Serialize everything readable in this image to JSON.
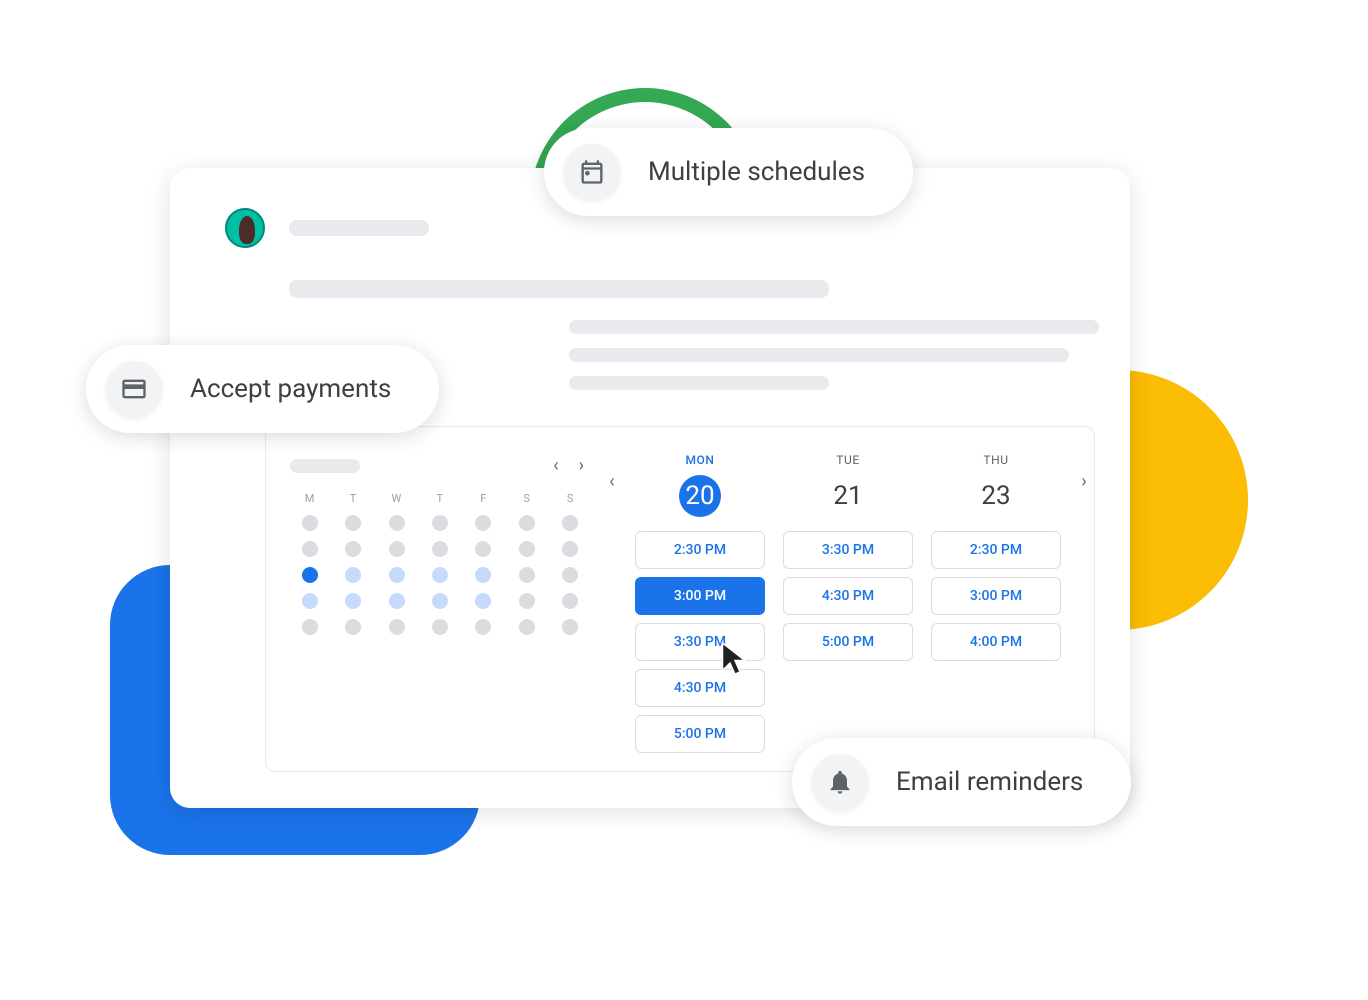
{
  "chips": {
    "multiple": "Multiple schedules",
    "payments": "Accept payments",
    "reminders": "Email reminders"
  },
  "calendar": {
    "weekdays": [
      "M",
      "T",
      "W",
      "T",
      "F",
      "S",
      "S"
    ],
    "rows": [
      [
        "g",
        "g",
        "g",
        "g",
        "g",
        "g",
        "g"
      ],
      [
        "g",
        "g",
        "g",
        "g",
        "g",
        "g",
        "g"
      ],
      [
        "sel",
        "a",
        "a",
        "a",
        "a",
        "g",
        "g"
      ],
      [
        "a",
        "a",
        "a",
        "a",
        "a",
        "g",
        "g"
      ],
      [
        "g",
        "g",
        "g",
        "g",
        "g",
        "g",
        "g"
      ]
    ]
  },
  "days": [
    {
      "dow": "MON",
      "num": "20",
      "active": true,
      "slots": [
        "2:30 PM",
        "3:00 PM",
        "3:30 PM",
        "4:30 PM",
        "5:00 PM"
      ],
      "selected": 1
    },
    {
      "dow": "TUE",
      "num": "21",
      "active": false,
      "slots": [
        "3:30 PM",
        "4:30 PM",
        "5:00 PM"
      ],
      "selected": -1
    },
    {
      "dow": "THU",
      "num": "23",
      "active": false,
      "slots": [
        "2:30 PM",
        "3:00 PM",
        "4:00 PM"
      ],
      "selected": -1
    }
  ]
}
